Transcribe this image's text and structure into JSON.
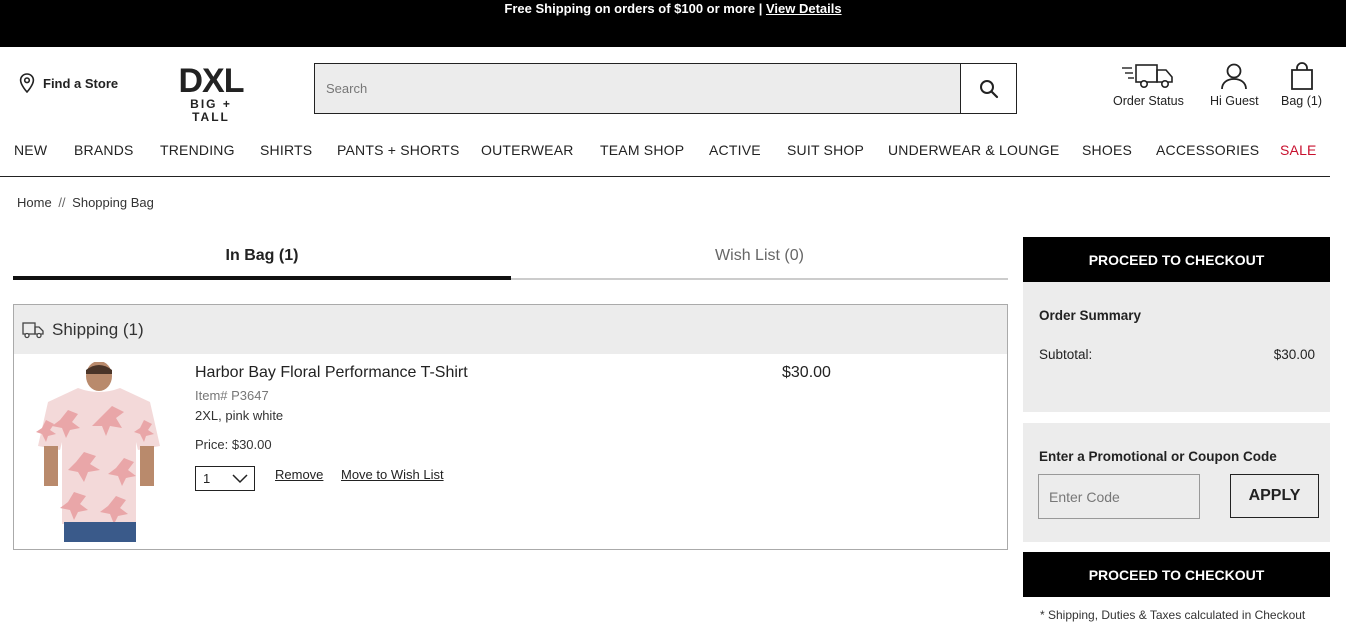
{
  "promo": {
    "text": "Free Shipping on orders of $100 or more",
    "separator": " | ",
    "link": "View Details"
  },
  "header": {
    "find_store": "Find a Store",
    "logo_main": "DXL",
    "logo_sub": "BIG + TALL",
    "search_placeholder": "Search",
    "order_status": "Order Status",
    "account": "Hi Guest",
    "bag": "Bag (1)"
  },
  "nav": {
    "items": [
      "NEW",
      "BRANDS",
      "TRENDING",
      "SHIRTS",
      "PANTS + SHORTS",
      "OUTERWEAR",
      "TEAM SHOP",
      "ACTIVE",
      "SUIT SHOP",
      "UNDERWEAR & LOUNGE",
      "SHOES",
      "ACCESSORIES",
      "SALE"
    ],
    "sale_color": "#c8102e"
  },
  "breadcrumb": {
    "home": "Home",
    "sep": "//",
    "current": "Shopping Bag"
  },
  "tabs": {
    "in_bag": "In Bag (1)",
    "wish_list": "Wish List (0)"
  },
  "shipping": {
    "header": "Shipping (1)",
    "item": {
      "name": "Harbor Bay Floral Performance T-Shirt",
      "sku": "Item# P3647",
      "variant": "2XL, pink white",
      "price": "Price: $30.00",
      "qty": "1",
      "remove": "Remove",
      "move": "Move to Wish List",
      "total": "$30.00"
    }
  },
  "summary": {
    "checkout": "PROCEED TO CHECKOUT",
    "title": "Order Summary",
    "subtotal_label": "Subtotal:",
    "subtotal_value": "$30.00",
    "promo_title": "Enter a Promotional or Coupon Code",
    "promo_placeholder": "Enter Code",
    "apply": "APPLY",
    "note": "* Shipping, Duties & Taxes calculated in Checkout"
  },
  "icons": [
    "location-pin-icon",
    "search-icon",
    "truck-icon",
    "user-icon",
    "bag-icon",
    "chevron-down-icon"
  ]
}
